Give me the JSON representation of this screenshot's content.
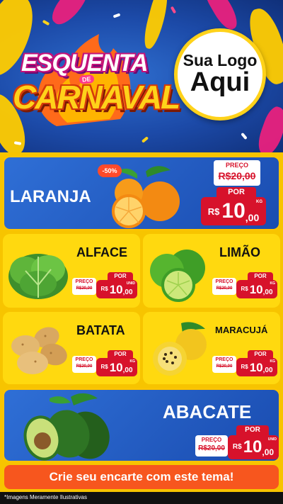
{
  "header": {
    "title_line1": "ESQUENTA",
    "title_de": "DE",
    "title_line2": "CARNAVAL",
    "logo_line1": "Sua Logo",
    "logo_line2": "Aqui"
  },
  "products": [
    {
      "name": "LARANJA",
      "discount": "-50%",
      "preco_label": "PREÇO",
      "old_price": "R$20,00",
      "por_label": "POR",
      "currency": "R$",
      "price_int": "10",
      "price_dec": ",00",
      "unit": "KG"
    },
    {
      "name": "ALFACE",
      "preco_label": "PREÇO",
      "old_price": "R$20,00",
      "por_label": "POR",
      "currency": "R$",
      "price_int": "10",
      "price_dec": ",00",
      "unit": "UNID"
    },
    {
      "name": "LIMÃO",
      "preco_label": "PREÇO",
      "old_price": "R$20,00",
      "por_label": "POR",
      "currency": "R$",
      "price_int": "10",
      "price_dec": ",00",
      "unit": "KG"
    },
    {
      "name": "BATATA",
      "preco_label": "PREÇO",
      "old_price": "R$20,00",
      "por_label": "POR",
      "currency": "R$",
      "price_int": "10",
      "price_dec": ",00",
      "unit": "KG"
    },
    {
      "name": "MARACUJÁ",
      "preco_label": "PREÇO",
      "old_price": "R$20,00",
      "por_label": "POR",
      "currency": "R$",
      "price_int": "10",
      "price_dec": ",00",
      "unit": "KG"
    },
    {
      "name": "ABACATE",
      "preco_label": "PREÇO",
      "old_price": "R$20,00",
      "por_label": "POR",
      "currency": "R$",
      "price_int": "10",
      "price_dec": ",00",
      "unit": "UNID"
    }
  ],
  "footer": {
    "cta": "Crie seu encarte com este tema!",
    "disclaimer": "*Imagens Meramente Ilustrativas"
  },
  "colors": {
    "header_blue": "#1c4aa8",
    "card_blue": "#2f6fd6",
    "card_yellow": "#ffd90f",
    "price_red": "#d7122b",
    "cta_orange": "#f7561e",
    "page_yellow": "#f7c400"
  }
}
